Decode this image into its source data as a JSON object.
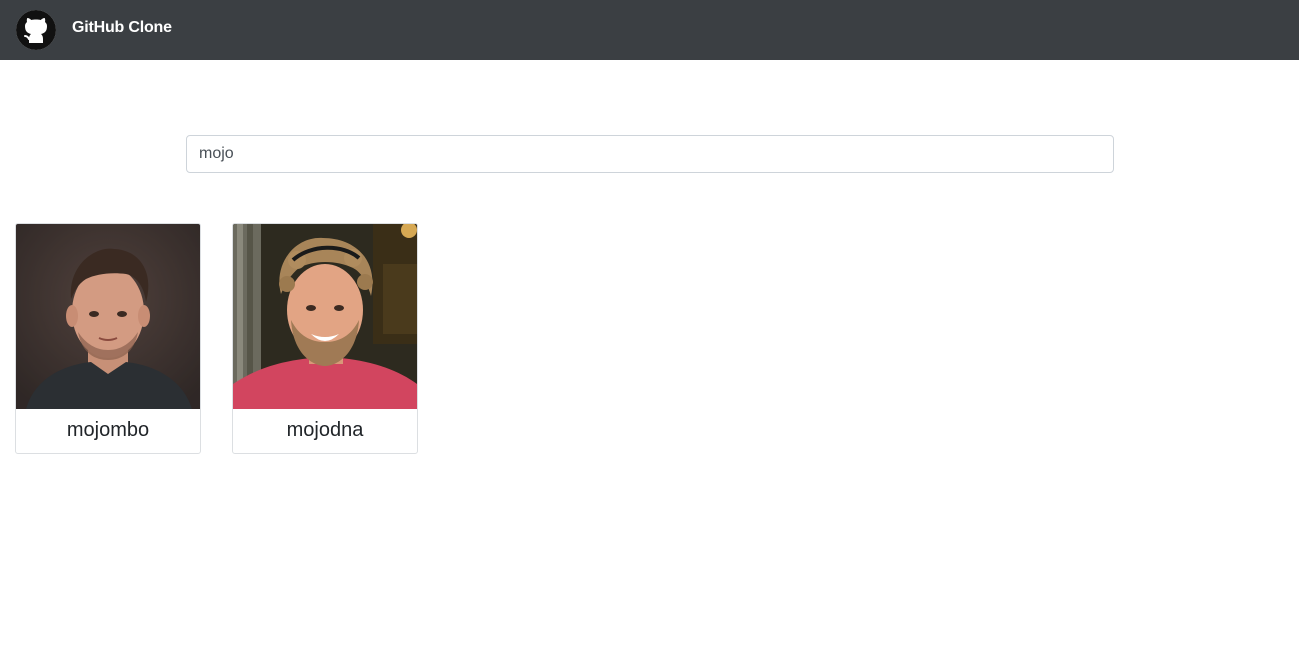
{
  "navbar": {
    "brand_title": "GitHub Clone",
    "logo_icon": "github-octocat-icon",
    "background": "#3b3f43"
  },
  "search": {
    "value": "mojo",
    "placeholder": ""
  },
  "users": [
    {
      "login": "mojombo",
      "avatar_icon": "avatar-photo"
    },
    {
      "login": "mojodna",
      "avatar_icon": "avatar-photo"
    }
  ]
}
